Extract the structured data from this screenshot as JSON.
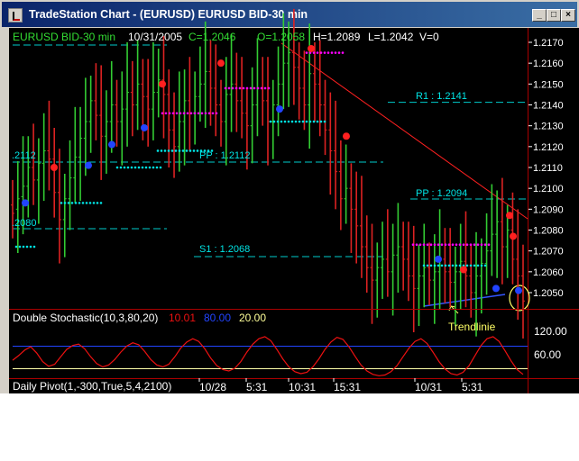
{
  "window": {
    "title": "TradeStation Chart - (EURUSD) EURUSD BID-30 min",
    "controls": {
      "minimize": "_",
      "maximize": "□",
      "close": "×"
    }
  },
  "header": {
    "symbol": "EURUSD BID-30 min",
    "date": "10/31/2005",
    "close": "C=1.2046",
    "open": "O=1.2058",
    "high": "H=1.2089",
    "low": "L=1.2042",
    "volume": "V=0"
  },
  "pivots": {
    "r1": "R1 : 1.2141",
    "pp1": "PP : 1.2112",
    "s1": "S1 : 1.2068",
    "pp2": "PP : 1.2094",
    "left_upper": ".2112",
    "left_lower": ".2080"
  },
  "annotation": {
    "trendline": "Trendlinie"
  },
  "indicator": {
    "name": "Double Stochastic(10,3,80,20)",
    "v1": "10.01",
    "v2": "80.00",
    "v3": "20.00",
    "axis_labels": [
      "120.00",
      "60.00"
    ]
  },
  "footer": {
    "study": "Daily Pivot(1,-300,True,5,4,2100)"
  },
  "x_axis": [
    "10/28",
    "5:31",
    "10:31",
    "15:31",
    "10/31",
    "5:31"
  ],
  "price_axis": [
    "1.2170",
    "1.2160",
    "1.2150",
    "1.2140",
    "1.2130",
    "1.2120",
    "1.2110",
    "1.2100",
    "1.2090",
    "1.2080",
    "1.2070",
    "1.2060",
    "1.2050"
  ],
  "colors": {
    "bull": "#33cc33",
    "bear": "#dd2222",
    "cyan": "#00e5e5",
    "magenta": "#ff00ff",
    "blue": "#2244ff",
    "red_dot": "#ff2020",
    "yellow": "#ffff66",
    "stoch": "#ee1111"
  },
  "chart_data": {
    "type": "bar",
    "title": "EURUSD BID-30 min",
    "ylim": [
      1.204,
      1.2175
    ],
    "price_ticks": [
      1.217,
      1.216,
      1.215,
      1.214,
      1.213,
      1.212,
      1.211,
      1.21,
      1.209,
      1.208,
      1.207,
      1.206,
      1.205
    ],
    "pivot_levels": {
      "R1": 1.2141,
      "PP_day1": 1.2112,
      "S1": 1.2068,
      "PP_day2": 1.2094
    },
    "last_bar": {
      "open": 1.2058,
      "high": 1.2089,
      "low": 1.2042,
      "close": 1.2046
    },
    "ohlc_path": [
      [
        1.2092,
        1.2088
      ],
      [
        1.209,
        1.2095
      ],
      [
        1.2096,
        1.2101
      ],
      [
        1.2101,
        1.211
      ],
      [
        1.211,
        1.2104
      ],
      [
        1.2104,
        1.2112
      ],
      [
        1.2112,
        1.2118
      ],
      [
        1.2118,
        1.2114
      ],
      [
        1.2114,
        1.2098
      ],
      [
        1.2098,
        1.2085
      ],
      [
        1.2085,
        1.2095
      ],
      [
        1.2095,
        1.2105
      ],
      [
        1.2105,
        1.2115
      ],
      [
        1.2115,
        1.2124
      ],
      [
        1.2124,
        1.2132
      ],
      [
        1.2132,
        1.2142
      ],
      [
        1.2142,
        1.2135
      ],
      [
        1.2135,
        1.2125
      ],
      [
        1.2125,
        1.2132
      ],
      [
        1.2132,
        1.214
      ],
      [
        1.214,
        1.2132
      ],
      [
        1.2132,
        1.2138
      ],
      [
        1.2138,
        1.2146
      ],
      [
        1.2146,
        1.214
      ],
      [
        1.214,
        1.215
      ],
      [
        1.215,
        1.2144
      ],
      [
        1.2144,
        1.2138
      ],
      [
        1.2138,
        1.2146
      ],
      [
        1.2146,
        1.2152
      ],
      [
        1.2152,
        1.2145
      ],
      [
        1.2145,
        1.2128
      ],
      [
        1.2128,
        1.212
      ],
      [
        1.212,
        1.2132
      ],
      [
        1.2132,
        1.2142
      ],
      [
        1.2142,
        1.2136
      ],
      [
        1.2136,
        1.2144
      ],
      [
        1.2144,
        1.215
      ],
      [
        1.215,
        1.2156
      ],
      [
        1.2156,
        1.2148
      ],
      [
        1.2148,
        1.214
      ],
      [
        1.214,
        1.2132
      ],
      [
        1.2132,
        1.2145
      ],
      [
        1.2145,
        1.215
      ],
      [
        1.215,
        1.2142
      ],
      [
        1.2142,
        1.2136
      ],
      [
        1.2136,
        1.213
      ],
      [
        1.213,
        1.214
      ],
      [
        1.214,
        1.2148
      ],
      [
        1.2148,
        1.2142
      ],
      [
        1.2142,
        1.2132
      ],
      [
        1.2132,
        1.214
      ],
      [
        1.214,
        1.215
      ],
      [
        1.215,
        1.216
      ],
      [
        1.216,
        1.2165
      ],
      [
        1.2165,
        1.2158
      ],
      [
        1.2158,
        1.2148
      ],
      [
        1.2148,
        1.214
      ],
      [
        1.214,
        1.2155
      ],
      [
        1.2155,
        1.215
      ],
      [
        1.215,
        1.214
      ],
      [
        1.214,
        1.2128
      ],
      [
        1.2128,
        1.2118
      ],
      [
        1.2118,
        1.2108
      ],
      [
        1.2108,
        1.2095
      ],
      [
        1.2095,
        1.21
      ],
      [
        1.21,
        1.209
      ],
      [
        1.209,
        1.2082
      ],
      [
        1.2082,
        1.2072
      ],
      [
        1.2072,
        1.2062
      ],
      [
        1.2062,
        1.2056
      ],
      [
        1.2056,
        1.2062
      ],
      [
        1.2062,
        1.2066
      ],
      [
        1.2066,
        1.206
      ],
      [
        1.206,
        1.2068
      ],
      [
        1.2068,
        1.2072
      ],
      [
        1.2072,
        1.2066
      ],
      [
        1.2066,
        1.2058
      ],
      [
        1.2058,
        1.2052
      ],
      [
        1.2052,
        1.2058
      ],
      [
        1.2058,
        1.2062
      ],
      [
        1.2062,
        1.2056
      ],
      [
        1.2056,
        1.206
      ],
      [
        1.206,
        1.2066
      ],
      [
        1.2066,
        1.206
      ],
      [
        1.206,
        1.2055
      ],
      [
        1.2055,
        1.206
      ],
      [
        1.206,
        1.2065
      ],
      [
        1.2065,
        1.2058
      ],
      [
        1.2058,
        1.205
      ],
      [
        1.205,
        1.2058
      ],
      [
        1.2058,
        1.2064
      ],
      [
        1.2064,
        1.207
      ],
      [
        1.207,
        1.2078
      ],
      [
        1.2078,
        1.2084
      ],
      [
        1.2084,
        1.2072
      ],
      [
        1.2072,
        1.208
      ],
      [
        1.208,
        1.2066
      ],
      [
        1.2066,
        1.2058
      ],
      [
        1.2058,
        1.2046
      ]
    ],
    "stochastic": {
      "ylim": [
        0,
        150
      ],
      "levels": [
        80,
        20
      ],
      "axis_ticks": [
        120,
        60
      ],
      "values": [
        48,
        62,
        78,
        88,
        70,
        44,
        30,
        36,
        58,
        80,
        92,
        96,
        82,
        58,
        38,
        28,
        34,
        50,
        72,
        90,
        100,
        94,
        74,
        50,
        34,
        28,
        36,
        58,
        84,
        102,
        112,
        104,
        82,
        54,
        32,
        20,
        16,
        24,
        44,
        72,
        96,
        112,
        118,
        106,
        80,
        52,
        28,
        14,
        8,
        12,
        28,
        52,
        80,
        102,
        116,
        110,
        88,
        60,
        34,
        16,
        6,
        2,
        4,
        14,
        32,
        58,
        84,
        104,
        112,
        98,
        72,
        44,
        22,
        8,
        4,
        12,
        32,
        62,
        92,
        112,
        118,
        104,
        76,
        46,
        20,
        6
      ]
    }
  }
}
